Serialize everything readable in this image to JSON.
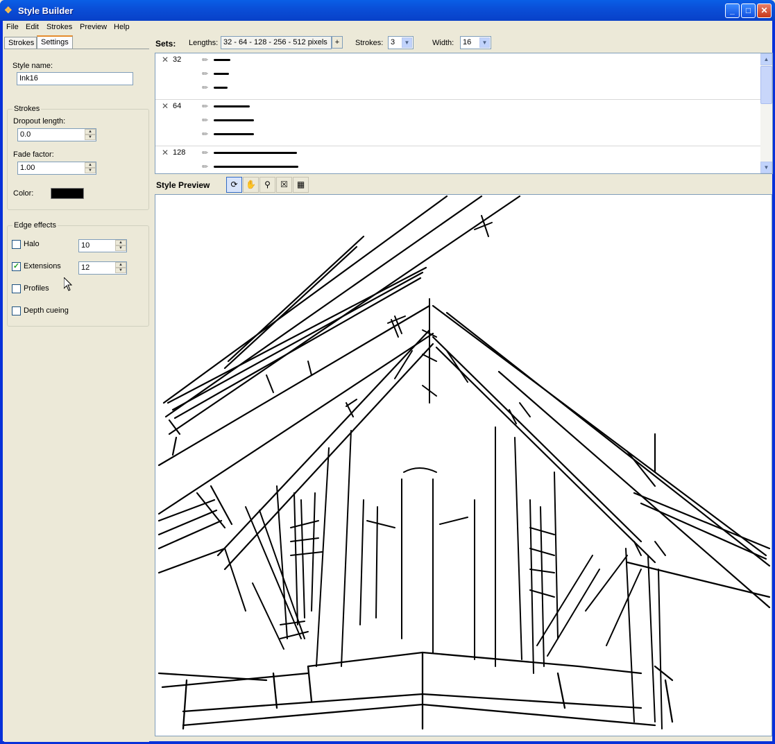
{
  "window": {
    "title": "Style Builder",
    "controls": [
      "minimize",
      "maximize",
      "close"
    ]
  },
  "menu": [
    "File",
    "Edit",
    "Strokes",
    "Preview",
    "Help"
  ],
  "left": {
    "tabs": [
      {
        "label": "Strokes",
        "active": false
      },
      {
        "label": "Settings",
        "active": true
      }
    ],
    "style_name_label": "Style name:",
    "style_name_value": "Ink16",
    "strokes_group": {
      "title": "Strokes",
      "dropout_label": "Dropout length:",
      "dropout_value": "0.0",
      "fade_label": "Fade factor:",
      "fade_value": "1.00",
      "color_label": "Color:",
      "color_value": "#000000"
    },
    "edge_group": {
      "title": "Edge effects",
      "halo_label": "Halo",
      "halo_checked": false,
      "halo_value": "10",
      "extensions_label": "Extensions",
      "extensions_checked": true,
      "extensions_value": "12",
      "profiles_label": "Profiles",
      "profiles_checked": false,
      "depth_label": "Depth cueing",
      "depth_checked": false
    }
  },
  "sets_bar": {
    "sets_label": "Sets:",
    "lengths_label": "Lengths:",
    "lengths_value": "32 - 64 - 128 - 256 - 512 pixels",
    "plus_label": "+",
    "strokes_label": "Strokes:",
    "strokes_value": "3",
    "width_label": "Width:",
    "width_value": "16"
  },
  "sets": [
    {
      "length": "32",
      "x_icon": "close-icon"
    },
    {
      "length": "64",
      "x_icon": "close-icon"
    },
    {
      "length": "128",
      "x_icon": "close-icon"
    }
  ],
  "preview": {
    "title": "Style Preview",
    "tools": [
      "orbit-icon",
      "pan-icon",
      "zoom-icon",
      "zoom-extents-icon",
      "cube-icon"
    ]
  }
}
